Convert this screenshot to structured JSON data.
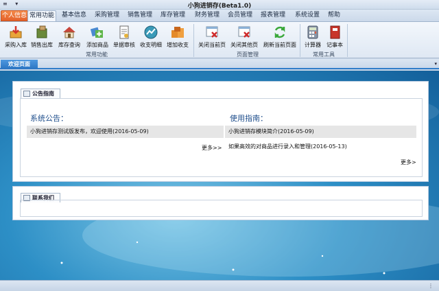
{
  "titlebar": {
    "title": "小狗进销存(Beta1.0)",
    "qa_icon": "≡",
    "qa_arrow": "▾"
  },
  "menu": {
    "tabs": [
      {
        "label": "个人信息",
        "kind": "special"
      },
      {
        "label": "常用功能",
        "kind": "active"
      },
      {
        "label": "基本信息"
      },
      {
        "label": "采购管理"
      },
      {
        "label": "销售管理"
      },
      {
        "label": "库存管理"
      },
      {
        "label": "财务管理"
      },
      {
        "label": "会员管理"
      },
      {
        "label": "报表管理"
      },
      {
        "label": "系统设置"
      },
      {
        "label": "帮助"
      }
    ]
  },
  "ribbon": {
    "group_common": "常用功能",
    "group_page": "页面管理",
    "group_tools": "常用工具",
    "buttons": [
      {
        "label": "采购入库",
        "icon": "purchase-in-icon"
      },
      {
        "label": "销售出库",
        "icon": "sales-out-icon"
      },
      {
        "label": "库存查询",
        "icon": "stock-query-icon"
      },
      {
        "label": "添加商品",
        "icon": "add-goods-icon"
      },
      {
        "label": "单据审核",
        "icon": "doc-audit-icon"
      },
      {
        "label": "收支明细",
        "icon": "income-detail-icon"
      },
      {
        "label": "增加收支",
        "icon": "add-income-icon"
      },
      {
        "label": "关闭当前页",
        "icon": "close-page-icon"
      },
      {
        "label": "关闭其他页",
        "icon": "close-others-icon"
      },
      {
        "label": "刷新当前页面",
        "icon": "refresh-icon"
      },
      {
        "label": "计算器",
        "icon": "calculator-icon"
      },
      {
        "label": "记事本",
        "icon": "notebook-icon"
      }
    ]
  },
  "doc_tabs": {
    "active": "欢迎页面",
    "dropdown": "▾"
  },
  "guide_panel": {
    "tab_label": "公告指南",
    "notice_title": "系统公告：",
    "notice_items": [
      "小狗进销存测试版发布，欢迎使用(2016-05-09)"
    ],
    "notice_more": "更多>>",
    "guide_title": "使用指南：",
    "guide_items": [
      "小狗进销存模块简介(2016-05-09)",
      "如果高效的对商品进行录入和管理(2016-05-13)"
    ],
    "guide_more": "更多>"
  },
  "contact_panel": {
    "tab_label": "联系我们"
  },
  "statusbar": {
    "grip": "⋮"
  },
  "colors": {
    "special_tab": "#e4602a",
    "accent": "#2e7dc9",
    "title_blue": "#1f4e8c"
  }
}
